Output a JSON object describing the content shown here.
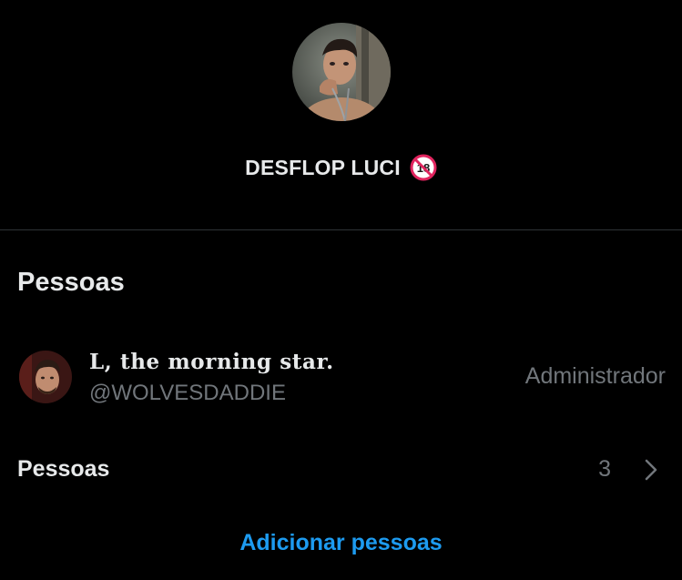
{
  "group": {
    "name": "DESFLOP LUCI",
    "badge_icon": "no-under-18-icon",
    "avatar_icon": "group-avatar-photo"
  },
  "people_section": {
    "title": "Pessoas",
    "members": [
      {
        "display_name": "L, the morning star.",
        "handle": "@WOLVESDADDIE",
        "role": "Administrador",
        "avatar_icon": "member-avatar-photo"
      }
    ],
    "people_row": {
      "label": "Pessoas",
      "count": "3",
      "chevron_icon": "chevron-right-icon"
    },
    "add_people_label": "Adicionar pessoas"
  },
  "colors": {
    "background": "#000000",
    "primary_text": "#e7e9ea",
    "secondary_text": "#71767b",
    "divider": "#2f3336",
    "accent": "#1d9bf0",
    "badge_red": "#e0245e"
  }
}
